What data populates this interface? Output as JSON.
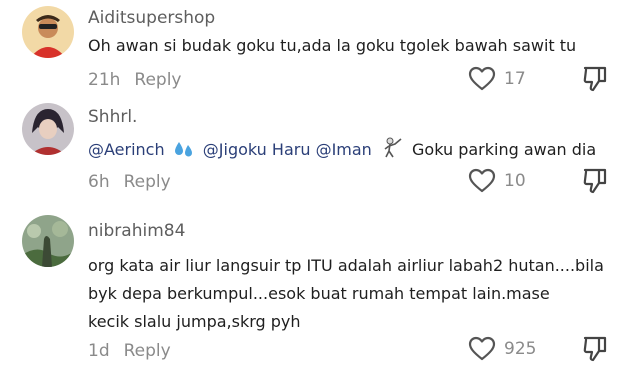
{
  "comments": [
    {
      "username": "Aiditsupershop",
      "text": "Oh awan si budak goku tu,ada la goku tgolek bawah sawit tu",
      "time": "21h",
      "reply_label": "Reply",
      "likes": "17"
    },
    {
      "username": "Shhrl.",
      "mentions": [
        "@Aerinch",
        "@Jigoku Haru",
        "@Iman"
      ],
      "text": "Goku parking awan dia",
      "time": "6h",
      "reply_label": "Reply",
      "likes": "10"
    },
    {
      "username": "nibrahim84",
      "lines": [
        "org kata air liur langsuir tp ITU adalah airliur labah2 hutan....bila",
        "byk depa berkumpul...esok buat rumah tempat lain.mase",
        "kecik slalu jumpa,skrg pyh"
      ],
      "time": "1d",
      "reply_label": "Reply",
      "likes": "925"
    }
  ],
  "icons": {
    "like": "heart-outline-icon",
    "dislike": "thumbs-down-icon",
    "emoji1": "sweat-droplets-emoji",
    "emoji2": "fencer-emoji"
  },
  "colors": {
    "mention": "#2b3f78",
    "meta": "#8a8a8a",
    "username": "#5e5e5e"
  }
}
